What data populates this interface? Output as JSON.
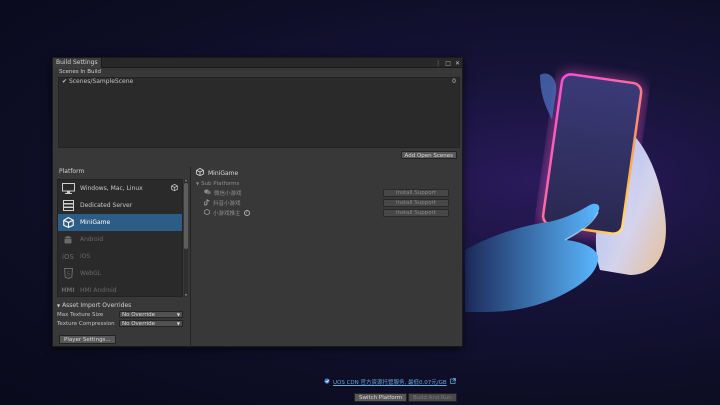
{
  "window": {
    "tab_title": "Build Settings",
    "controls": [
      "⋮",
      "□",
      "✕"
    ]
  },
  "scenes": {
    "header": "Scenes In Build",
    "items": [
      {
        "checked": true,
        "name": "Scenes/SampleScene",
        "index": "0"
      }
    ],
    "add_button": "Add Open Scenes"
  },
  "platform": {
    "title": "Platform",
    "items": [
      {
        "label": "Windows, Mac, Linux",
        "icon": "monitor-icon",
        "state": "normal",
        "active_badge": true
      },
      {
        "label": "Dedicated Server",
        "icon": "server-icon",
        "state": "normal"
      },
      {
        "label": "MiniGame",
        "icon": "minigame-icon",
        "state": "selected"
      },
      {
        "label": "Android",
        "icon": "android-icon",
        "state": "disabled"
      },
      {
        "label": "iOS",
        "icon": "ios-icon",
        "state": "disabled"
      },
      {
        "label": "WebGL",
        "icon": "html5-icon",
        "state": "disabled"
      },
      {
        "label": "HMI Android",
        "icon": "hmi-icon",
        "state": "disabled"
      }
    ]
  },
  "asset_overrides": {
    "title": "Asset Import Overrides",
    "max_texture_label": "Max Texture Size",
    "max_texture_value": "No Override",
    "compression_label": "Texture Compression",
    "compression_value": "No Override"
  },
  "player_settings_button": "Player Settings...",
  "right_panel": {
    "title": "MiniGame",
    "sub_platforms_label": "Sub Platforms",
    "sub_platforms": [
      {
        "label": "微信小游戏",
        "icon": "wechat-icon",
        "button": "Install Support"
      },
      {
        "label": "抖音小游戏",
        "icon": "douyin-icon",
        "button": "Install Support"
      },
      {
        "label": "小游戏推主",
        "icon": "unity-icon",
        "button": "Install Support",
        "help": true
      }
    ],
    "cdn_link": "UOS CDN 官方资源托管服务, 最低0.07元/GB",
    "switch_platform": "Switch Platform",
    "build_and_run": "Build And Run"
  },
  "colors": {
    "selection": "#2c5d87",
    "link": "#6aa8e0",
    "neon_pink": "#ff3aa8",
    "neon_orange": "#ffb347",
    "neon_cyan": "#5ad8ff"
  }
}
